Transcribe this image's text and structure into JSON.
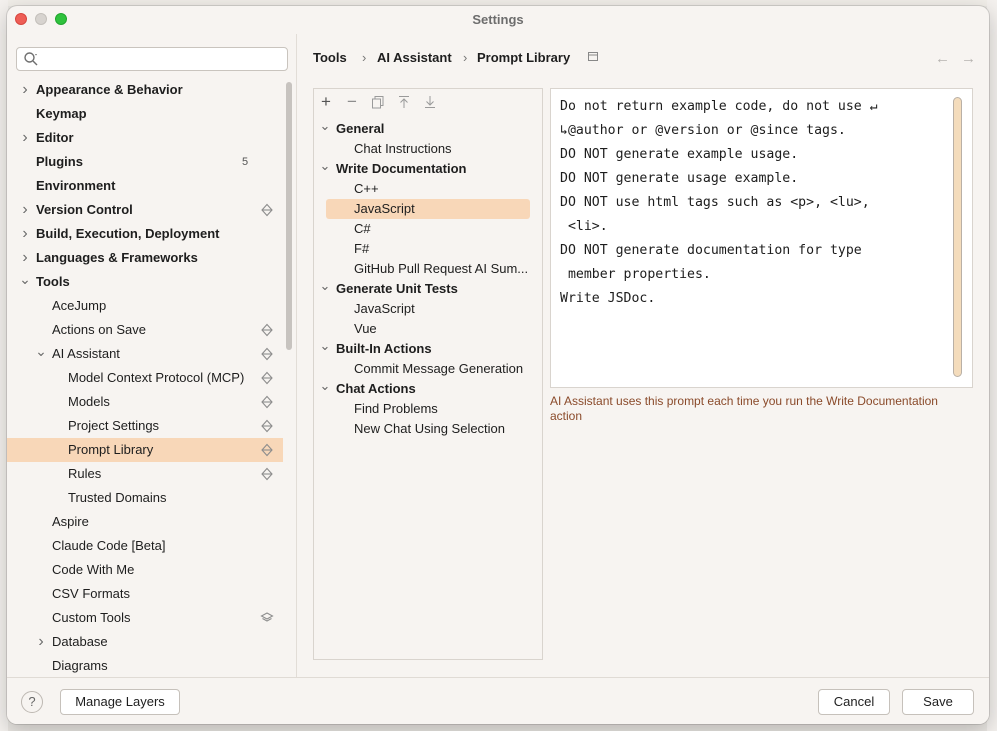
{
  "window": {
    "title": "Settings"
  },
  "search": {
    "placeholder": ""
  },
  "sidebar": {
    "items": [
      {
        "label": "Appearance & Behavior",
        "bold": true,
        "arrow": "right"
      },
      {
        "label": "Keymap",
        "bold": true
      },
      {
        "label": "Editor",
        "bold": true,
        "arrow": "right"
      },
      {
        "label": "Plugins",
        "bold": true,
        "count": "5"
      },
      {
        "label": "Environment",
        "bold": true
      },
      {
        "label": "Version Control",
        "bold": true,
        "arrow": "right",
        "icon": "layers-icon"
      },
      {
        "label": "Build, Execution, Deployment",
        "bold": true,
        "arrow": "right"
      },
      {
        "label": "Languages & Frameworks",
        "bold": true,
        "arrow": "right"
      },
      {
        "label": "Tools",
        "bold": true,
        "arrow": "down"
      },
      {
        "label": "AceJump"
      },
      {
        "label": "Actions on Save",
        "icon": "layers-icon"
      },
      {
        "label": "AI Assistant",
        "arrow": "down",
        "icon": "layers-icon"
      },
      {
        "label": "Model Context Protocol (MCP)",
        "icon": "layers-icon"
      },
      {
        "label": "Models",
        "icon": "layers-icon"
      },
      {
        "label": "Project Settings",
        "icon": "layers-icon"
      },
      {
        "label": "Prompt Library",
        "icon": "layers-icon",
        "selected": true
      },
      {
        "label": "Rules",
        "icon": "layers-icon"
      },
      {
        "label": "Trusted Domains"
      },
      {
        "label": "Aspire"
      },
      {
        "label": "Claude Code [Beta]"
      },
      {
        "label": "Code With Me"
      },
      {
        "label": "CSV Formats"
      },
      {
        "label": "Custom Tools",
        "icon": "stack-icon"
      },
      {
        "label": "Database",
        "arrow": "right"
      },
      {
        "label": "Diagrams"
      }
    ]
  },
  "breadcrumb": {
    "part1": "Tools",
    "part2": "AI Assistant",
    "part3": "Prompt Library",
    "sep": "›"
  },
  "prompts": {
    "groups": [
      {
        "label": "General",
        "bold": true,
        "arrow": "down"
      },
      {
        "label": "Chat Instructions"
      },
      {
        "label": "Write Documentation",
        "bold": true,
        "arrow": "down"
      },
      {
        "label": "C++"
      },
      {
        "label": "JavaScript",
        "selected": true
      },
      {
        "label": "C#"
      },
      {
        "label": "F#"
      },
      {
        "label": "GitHub Pull Request AI Sum..."
      },
      {
        "label": "Generate Unit Tests",
        "bold": true,
        "arrow": "down"
      },
      {
        "label": "JavaScript"
      },
      {
        "label": "Vue"
      },
      {
        "label": "Built-In Actions",
        "bold": true,
        "arrow": "down"
      },
      {
        "label": "Commit Message Generation"
      },
      {
        "label": "Chat Actions",
        "bold": true,
        "arrow": "down"
      },
      {
        "label": "Find Problems"
      },
      {
        "label": "New Chat Using Selection"
      }
    ]
  },
  "editor": {
    "lines": [
      "Do not return example code, do not use ↵",
      "↳@author or @version or @since tags.",
      "DO NOT generate example usage.",
      "DO NOT generate usage example.",
      "DO NOT use html tags such as <p>, <lu>,",
      " <li>.",
      "DO NOT generate documentation for type",
      " member properties.",
      "Write JSDoc."
    ]
  },
  "hint": "AI Assistant uses this prompt each time you run the Write Documentation action",
  "footer": {
    "manage_layers": "Manage Layers",
    "cancel": "Cancel",
    "save": "Save",
    "help": "?"
  },
  "colors": {
    "selection": "#f8d7b8",
    "hint": "#8a4a2a"
  }
}
